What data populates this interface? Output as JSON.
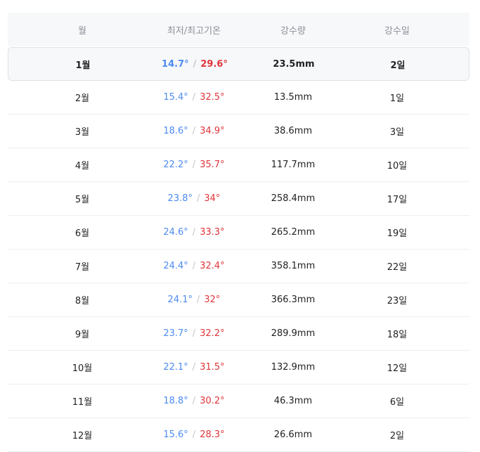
{
  "headers": [
    "월",
    "최저/최고기온",
    "강수량",
    "강수일"
  ],
  "separator": "/",
  "months": [
    {
      "month": "1월",
      "low": "14.7°",
      "high": "29.6°",
      "rain": "23.5mm",
      "days": "2일"
    },
    {
      "month": "2월",
      "low": "15.4°",
      "high": "32.5°",
      "rain": "13.5mm",
      "days": "1일"
    },
    {
      "month": "3월",
      "low": "18.6°",
      "high": "34.9°",
      "rain": "38.6mm",
      "days": "3일"
    },
    {
      "month": "4월",
      "low": "22.2°",
      "high": "35.7°",
      "rain": "117.7mm",
      "days": "10일"
    },
    {
      "month": "5월",
      "low": "23.8°",
      "high": "34°",
      "rain": "258.4mm",
      "days": "17일"
    },
    {
      "month": "6월",
      "low": "24.6°",
      "high": "33.3°",
      "rain": "265.2mm",
      "days": "19일"
    },
    {
      "month": "7월",
      "low": "24.4°",
      "high": "32.4°",
      "rain": "358.1mm",
      "days": "22일"
    },
    {
      "month": "8월",
      "low": "24.1°",
      "high": "32°",
      "rain": "366.3mm",
      "days": "23일"
    },
    {
      "month": "9월",
      "low": "23.7°",
      "high": "32.2°",
      "rain": "289.9mm",
      "days": "18일"
    },
    {
      "month": "10월",
      "low": "22.1°",
      "high": "31.5°",
      "rain": "132.9mm",
      "days": "12일"
    },
    {
      "month": "11월",
      "low": "18.8°",
      "high": "30.2°",
      "rain": "46.3mm",
      "days": "6일"
    },
    {
      "month": "12월",
      "low": "15.6°",
      "high": "28.3°",
      "rain": "26.6mm",
      "days": "2일"
    }
  ],
  "colors": {
    "low": "#4d8bf0",
    "high": "#e0353a",
    "header_bg": "#f7f8fa",
    "highlight_border": "#dfe2e6"
  }
}
